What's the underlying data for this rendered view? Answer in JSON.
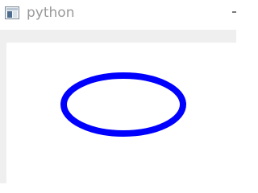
{
  "window": {
    "title": "python",
    "icon": "app-window-icon"
  },
  "canvas": {
    "background": "#ffffff",
    "shape": "ellipse",
    "stroke_color": "#0000ff",
    "fill": "none"
  }
}
